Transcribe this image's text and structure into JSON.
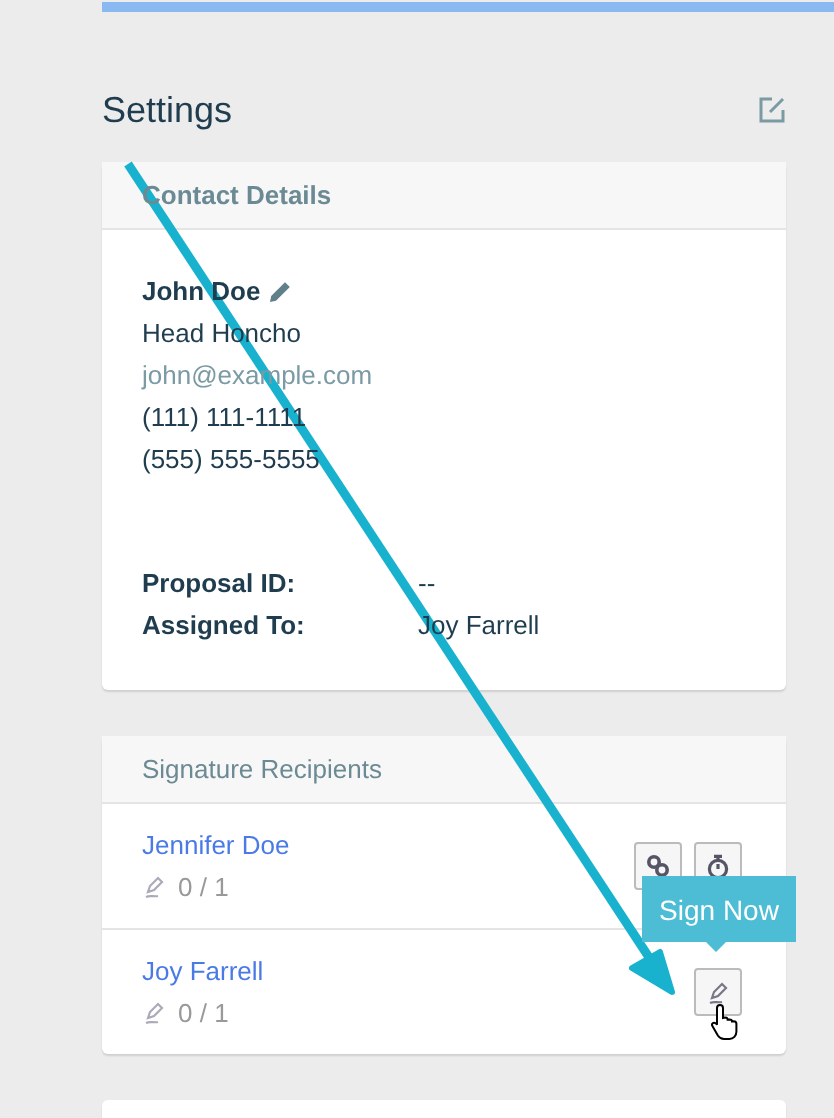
{
  "settings": {
    "title": "Settings"
  },
  "contact_details": {
    "title": "Contact Details",
    "name": "John Doe",
    "job_title": "Head Honcho",
    "email": "john@example.com",
    "phones": [
      "(111) 111-1111",
      "(555) 555-5555"
    ],
    "fields": [
      {
        "label": "Proposal ID:",
        "value": "--"
      },
      {
        "label": "Assigned To:",
        "value": "Joy Farrell"
      }
    ]
  },
  "signature_recipients": {
    "title": "Signature Recipients",
    "recipients": [
      {
        "name": "Jennifer Doe",
        "progress": "0 / 1",
        "actions": [
          {
            "kind": "link"
          },
          {
            "kind": "timer"
          }
        ]
      },
      {
        "name": "Joy Farrell",
        "progress": "0 / 1",
        "actions": [
          {
            "kind": "sign"
          }
        ]
      }
    ]
  },
  "tooltip": "Sign Now"
}
